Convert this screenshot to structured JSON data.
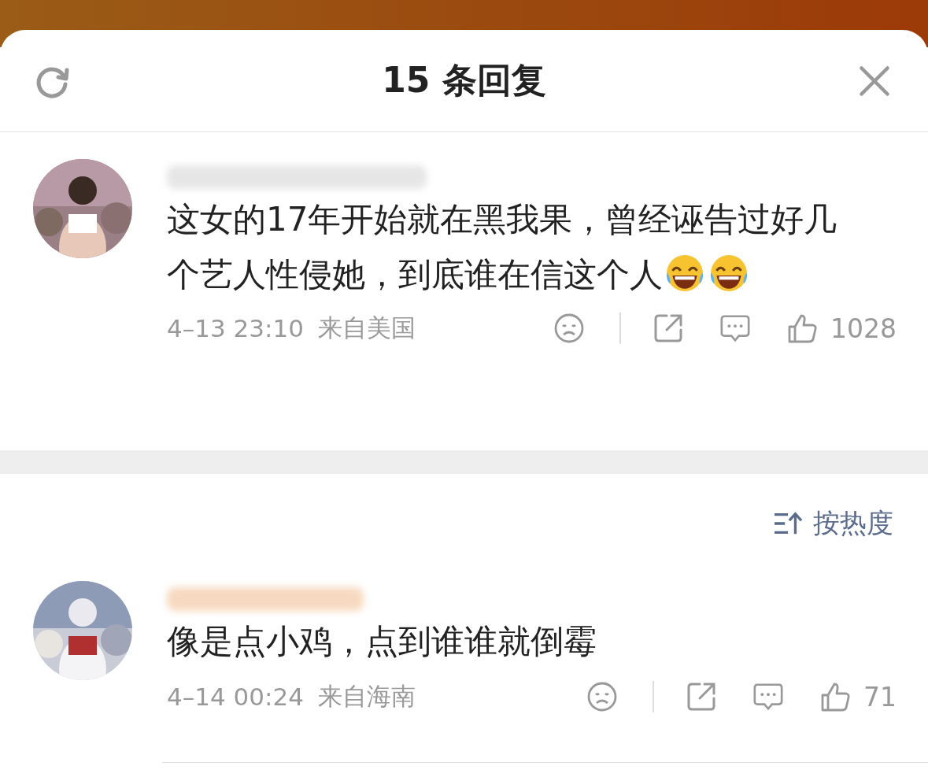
{
  "header": {
    "title": "15 条回复"
  },
  "comments": [
    {
      "text": "这女的17年开始就在黑我果，曾经诬告过好几个艺人性侵她，到底谁在信这个人",
      "emoji": [
        {
          "kind": "laugh"
        },
        {
          "kind": "laugh"
        }
      ],
      "time": "4–13 23:10",
      "location": "来自美国",
      "likes": "1028"
    },
    {
      "text": "像是点小鸡，点到谁谁就倒霉",
      "time": "4–14 00:24",
      "location": "来自海南",
      "likes": "71"
    }
  ],
  "sort": {
    "label": "按热度"
  }
}
